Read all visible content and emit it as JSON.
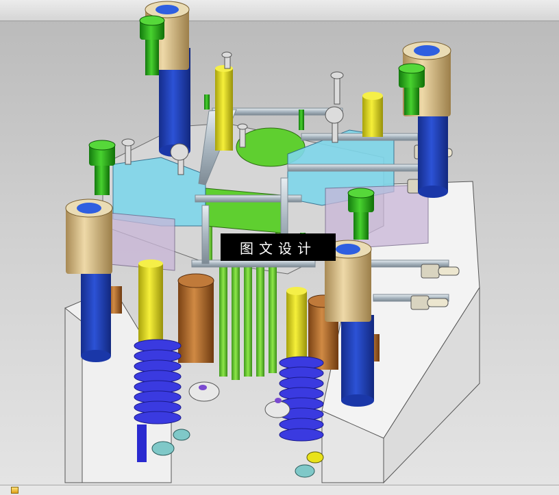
{
  "app": {
    "watermark_text": "图文设计"
  },
  "viewport": {
    "model": "mold-assembly-3d",
    "colors": {
      "background_top": "#b9b9b9",
      "background_bottom": "#e4e4e4",
      "plate": "#f2f2f2",
      "bolt_green": "#2fb51e",
      "pillar_blue": "#1f3fb8",
      "bushing_tan": "#d8c08a",
      "pin_yellow": "#e9e21a",
      "spring_blue": "#3a3ae0",
      "slider_cyan": "#7fd7ea",
      "core_green": "#6fd23a",
      "block_brown": "#b5692a",
      "pipe_gray": "#b9c4cc"
    }
  },
  "statusbar": {
    "icon": "part-icon"
  }
}
